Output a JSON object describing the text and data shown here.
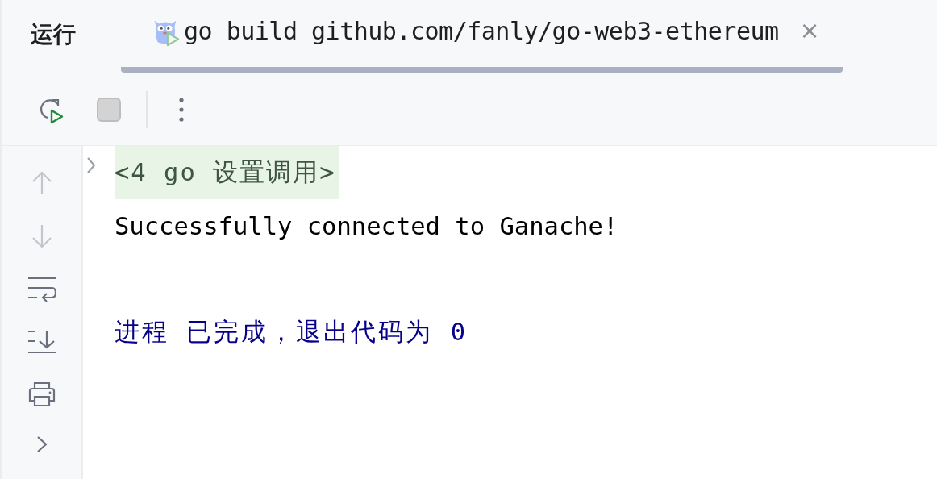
{
  "panel": {
    "title": "运行"
  },
  "tabs": [
    {
      "label": "go build github.com/fanly/go-web3-ethereum",
      "selected": true,
      "close": "×"
    }
  ],
  "toolbar": [
    {
      "kind": "rerun"
    },
    {
      "kind": "stop"
    },
    {
      "kind": "separator"
    },
    {
      "kind": "more"
    }
  ],
  "sidebar": [
    {
      "kind": "up",
      "disabled": true
    },
    {
      "kind": "down",
      "disabled": true
    },
    {
      "kind": "wrap",
      "disabled": false
    },
    {
      "kind": "scroll-end",
      "disabled": false
    },
    {
      "kind": "print",
      "disabled": false
    },
    {
      "kind": "expand",
      "disabled": false
    }
  ],
  "console": [
    {
      "kind": "fold",
      "text": "<4 go 设置调用>",
      "expanded": false
    },
    {
      "kind": "stdout",
      "text": "Successfully connected to Ganache!"
    },
    {
      "kind": "exit",
      "text": "进程 已完成，退出代码为 0"
    }
  ]
}
